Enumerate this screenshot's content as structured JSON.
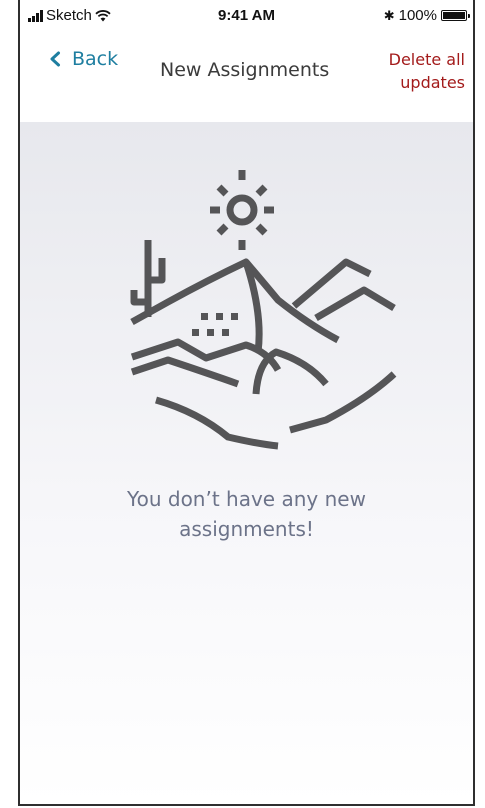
{
  "status_bar": {
    "carrier": "Sketch",
    "time": "9:41 AM",
    "battery_text": "100%",
    "battery_level": 1.0
  },
  "nav": {
    "back_label": "Back",
    "title": "New Assignments",
    "delete_line1": "Delete all",
    "delete_line2": "updates"
  },
  "empty_state": {
    "illustration_icon": "desert-landscape-icon",
    "message_line1": "You don’t have any new",
    "message_line2": "assignments!"
  },
  "colors": {
    "accent": "#1e7ea0",
    "destructive": "#a31b1b",
    "illustration": "#555557",
    "message": "#6c7389"
  }
}
